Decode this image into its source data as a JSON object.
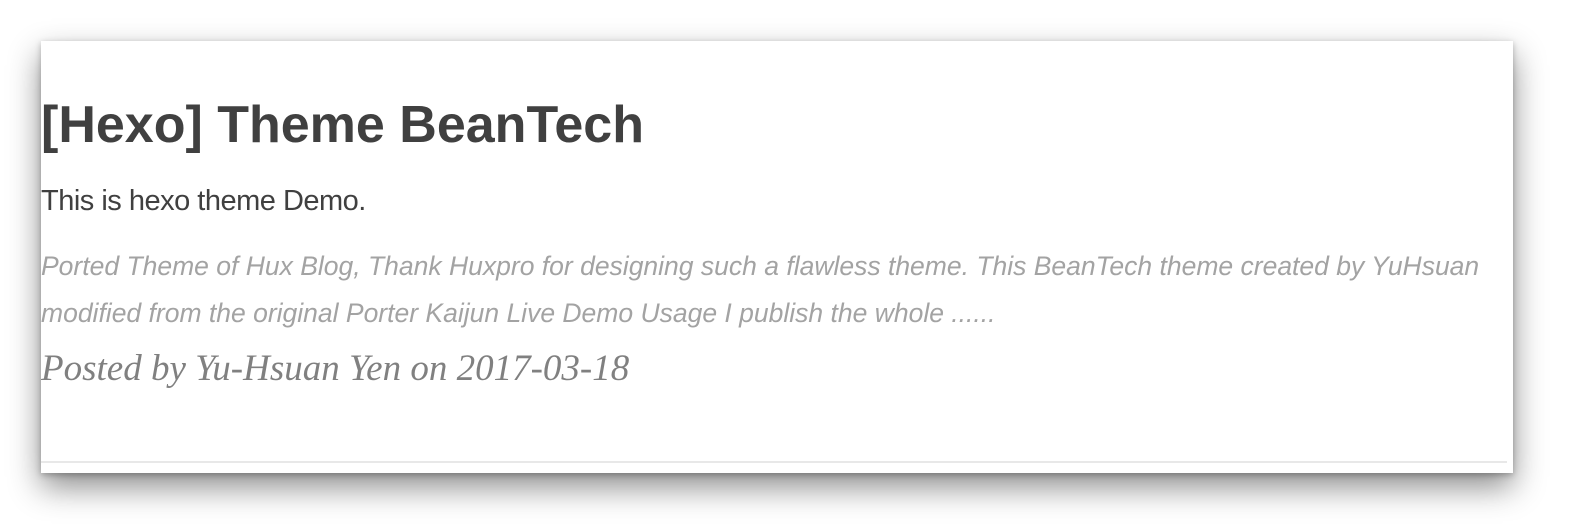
{
  "post": {
    "title": "[Hexo] Theme BeanTech",
    "subtitle": "This is hexo theme Demo.",
    "excerpt": "Ported Theme of Hux Blog, Thank Huxpro for designing such a flawless theme. This BeanTech theme created by YuHsuan modified from the original Porter Kaijun Live Demo Usage I publish the whole ......",
    "meta": "Posted by Yu-Hsuan Yen on 2017-03-18"
  }
}
